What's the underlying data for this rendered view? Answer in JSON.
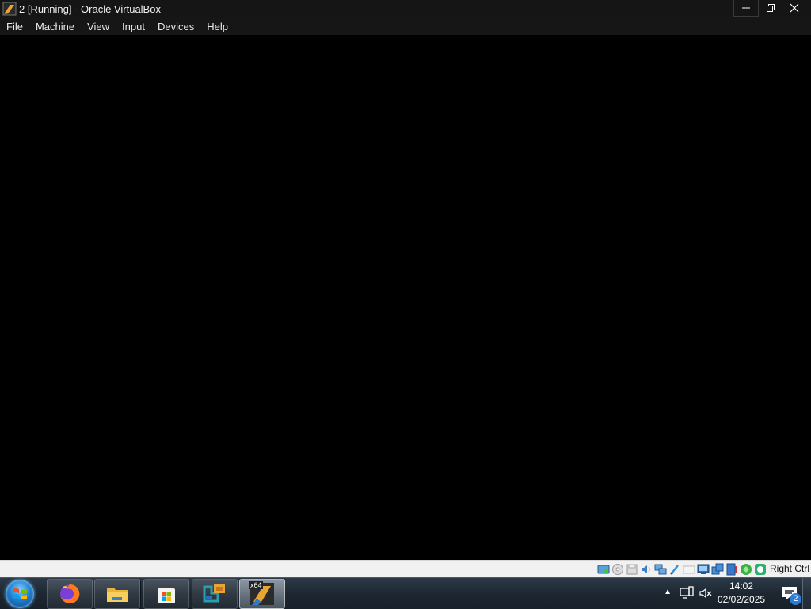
{
  "window": {
    "title": "2 [Running] - Oracle VirtualBox",
    "icon": "virtualbox-icon"
  },
  "menu": [
    "File",
    "Machine",
    "View",
    "Input",
    "Devices",
    "Help"
  ],
  "statusbar": {
    "host_key": "Right Ctrl",
    "icons": [
      "hard-disk-icon",
      "optical-drive-icon",
      "floppy-icon",
      "audio-icon",
      "network-icon",
      "usb-icon",
      "shared-folders-icon",
      "display-icon",
      "video-capture-icon",
      "recording-icon",
      "cpu-icon",
      "mouse-integration-icon",
      "keyboard-icon"
    ]
  },
  "taskbar": {
    "pinned": [
      "firefox-icon",
      "file-explorer-icon",
      "microsoft-store-icon",
      "virtualbox-manager-icon",
      "virtualbox-vm-icon"
    ],
    "vm_badge": "x64"
  },
  "tray": {
    "time": "14:02",
    "date": "02/02/2025",
    "notification_count": "2"
  }
}
